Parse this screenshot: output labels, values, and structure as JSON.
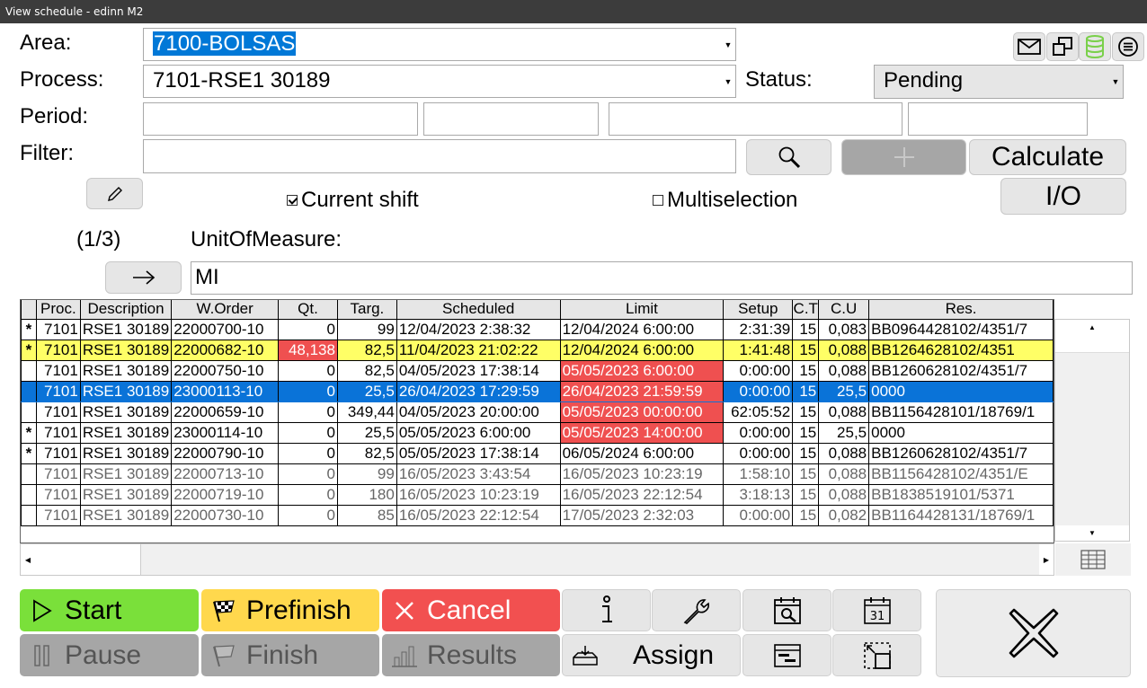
{
  "window": {
    "title": "View schedule - edinn M2"
  },
  "labels": {
    "area": "Area:",
    "process": "Process:",
    "status": "Status:",
    "period": "Period:",
    "filter": "Filter:",
    "page_indicator": "(1/3)",
    "unit_label": "UnitOfMeasure:"
  },
  "fields": {
    "area_value": "7100-BOLSAS",
    "process_value": "7101-RSE1 30189",
    "status_value": "Pending",
    "period": [
      "",
      "",
      "",
      ""
    ],
    "filter_value": "",
    "unit_value": "MI"
  },
  "buttons": {
    "calculate": "Calculate",
    "io": "I/O",
    "current_shift": "Current shift",
    "multiselection": "Multiselection",
    "start": "Start",
    "prefinish": "Prefinish",
    "cancel": "Cancel",
    "pause": "Pause",
    "finish": "Finish",
    "results": "Results",
    "assign": "Assign"
  },
  "checks": {
    "current_shift": true,
    "multiselection": false
  },
  "table": {
    "headers": [
      "",
      "Proc.",
      "Description",
      "W.Order",
      "Qt.",
      "Targ.",
      "Scheduled",
      "Limit",
      "Setup",
      "C.T",
      "C.U",
      "Res."
    ],
    "rows": [
      {
        "style": "",
        "mark": "*",
        "proc": "7101",
        "desc": "RSE1 30189",
        "order": "22000700-10",
        "qt": "0",
        "targ": "99",
        "sched": "12/04/2023 2:38:32",
        "limit": "12/04/2024 6:00:00",
        "setup": "2:31:39",
        "ct": "15",
        "cu": "0,083",
        "res": "BB0964428102/4351/7",
        "qt_red": false,
        "limit_red": false
      },
      {
        "style": "yellow",
        "mark": "*",
        "proc": "7101",
        "desc": "RSE1 30189",
        "order": "22000682-10",
        "qt": "48,138",
        "targ": "82,5",
        "sched": "11/04/2023 21:02:22",
        "limit": "12/04/2024 6:00:00",
        "setup": "1:41:48",
        "ct": "15",
        "cu": "0,088",
        "res": "BB1264628102/4351",
        "qt_red": true,
        "limit_red": false
      },
      {
        "style": "",
        "mark": "",
        "proc": "7101",
        "desc": "RSE1 30189",
        "order": "22000750-10",
        "qt": "0",
        "targ": "82,5",
        "sched": "04/05/2023 17:38:14",
        "limit": "05/05/2023 6:00:00",
        "setup": "0:00:00",
        "ct": "15",
        "cu": "0,088",
        "res": "BB1260628102/4351/7",
        "qt_red": false,
        "limit_red": true
      },
      {
        "style": "blue",
        "mark": "",
        "proc": "7101",
        "desc": "RSE1 30189",
        "order": "23000113-10",
        "qt": "0",
        "targ": "25,5",
        "sched": "26/04/2023 17:29:59",
        "limit": "26/04/2023 21:59:59",
        "setup": "0:00:00",
        "ct": "15",
        "cu": "25,5",
        "res": "0000",
        "qt_red": false,
        "limit_red": true
      },
      {
        "style": "",
        "mark": "",
        "proc": "7101",
        "desc": "RSE1 30189",
        "order": "22000659-10",
        "qt": "0",
        "targ": "349,44",
        "sched": "04/05/2023 20:00:00",
        "limit": "05/05/2023 00:00:00",
        "setup": "62:05:52",
        "ct": "15",
        "cu": "0,088",
        "res": "BB1156428101/18769/1",
        "qt_red": false,
        "limit_red": true
      },
      {
        "style": "",
        "mark": "*",
        "proc": "7101",
        "desc": "RSE1 30189",
        "order": "23000114-10",
        "qt": "0",
        "targ": "25,5",
        "sched": "05/05/2023 6:00:00",
        "limit": "05/05/2023 14:00:00",
        "setup": "0:00:00",
        "ct": "15",
        "cu": "25,5",
        "res": "0000",
        "qt_red": false,
        "limit_red": true
      },
      {
        "style": "",
        "mark": "*",
        "proc": "7101",
        "desc": "RSE1 30189",
        "order": "22000790-10",
        "qt": "0",
        "targ": "82,5",
        "sched": "05/05/2023 17:38:14",
        "limit": "06/05/2024 6:00:00",
        "setup": "0:00:00",
        "ct": "15",
        "cu": "0,088",
        "res": "BB1260628102/4351/7",
        "qt_red": false,
        "limit_red": false
      },
      {
        "style": "gray",
        "mark": "",
        "proc": "7101",
        "desc": "RSE1 30189",
        "order": "22000713-10",
        "qt": "0",
        "targ": "99",
        "sched": "16/05/2023 3:43:54",
        "limit": "16/05/2023 10:23:19",
        "setup": "1:58:10",
        "ct": "15",
        "cu": "0,088",
        "res": "BB1156428102/4351/E",
        "qt_red": false,
        "limit_red": false
      },
      {
        "style": "gray",
        "mark": "",
        "proc": "7101",
        "desc": "RSE1 30189",
        "order": "22000719-10",
        "qt": "0",
        "targ": "180",
        "sched": "16/05/2023 10:23:19",
        "limit": "16/05/2023 22:12:54",
        "setup": "3:18:13",
        "ct": "15",
        "cu": "0,088",
        "res": "BB1838519101/5371",
        "qt_red": false,
        "limit_red": false
      },
      {
        "style": "gray",
        "mark": "",
        "proc": "7101",
        "desc": "RSE1 30189",
        "order": "22000730-10",
        "qt": "0",
        "targ": "85",
        "sched": "16/05/2023 22:12:54",
        "limit": "17/05/2023 2:32:03",
        "setup": "0:00:00",
        "ct": "15",
        "cu": "0,082",
        "res": "BB1164428131/18769/1",
        "qt_red": false,
        "limit_red": false
      }
    ]
  },
  "icons": {
    "mail": "mail-icon",
    "windows": "windows-icon",
    "database": "database-icon",
    "menu": "menu-icon",
    "search": "search-icon",
    "add": "add-icon",
    "edit": "pencil-icon",
    "next": "arrow-right-icon"
  },
  "colors": {
    "start": "#7ae03a",
    "prefinish": "#ffd84d",
    "cancel": "#f25050",
    "row_highlight": "#ffff66",
    "row_selected": "#0a73d8",
    "limit_alert": "#ef5050"
  }
}
